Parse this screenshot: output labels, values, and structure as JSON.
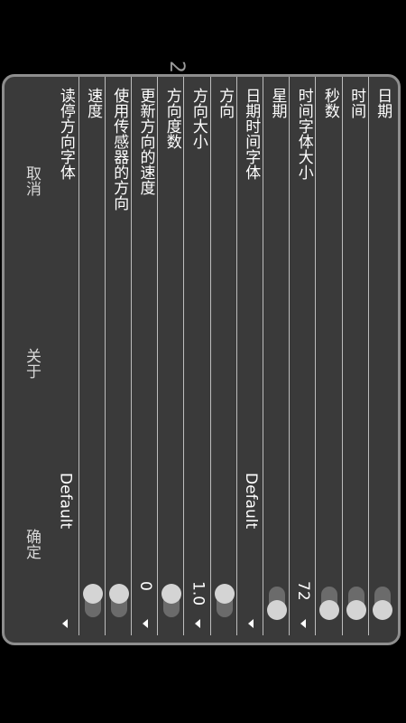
{
  "corner_digit": "2",
  "rows": [
    {
      "label": "日期",
      "control": "toggle",
      "state": "on"
    },
    {
      "label": "时间",
      "control": "toggle",
      "state": "on"
    },
    {
      "label": "秒数",
      "control": "toggle",
      "state": "on"
    },
    {
      "label": "时间字体大小",
      "control": "value",
      "value": "72",
      "arrow": true
    },
    {
      "label": "星期",
      "control": "toggle",
      "state": "on"
    },
    {
      "label": "日期时间字体",
      "control": "value",
      "value": "Default",
      "arrow": true
    },
    {
      "label": "方向",
      "control": "toggle",
      "state": "off"
    },
    {
      "label": "方向大小",
      "control": "value",
      "value": "1.0",
      "arrow": true
    },
    {
      "label": "方向度数",
      "control": "toggle",
      "state": "off"
    },
    {
      "label": "更新方向的速度",
      "control": "value",
      "value": "0",
      "arrow": true
    },
    {
      "label": "使用传感器的方向",
      "control": "toggle",
      "state": "off"
    },
    {
      "label": "速度",
      "control": "toggle",
      "state": "off"
    },
    {
      "label": "读停方向字体",
      "control": "value",
      "value": "Default",
      "arrow": true
    }
  ],
  "actions": {
    "confirm": "确定",
    "about": "关于",
    "cancel": "取消"
  }
}
